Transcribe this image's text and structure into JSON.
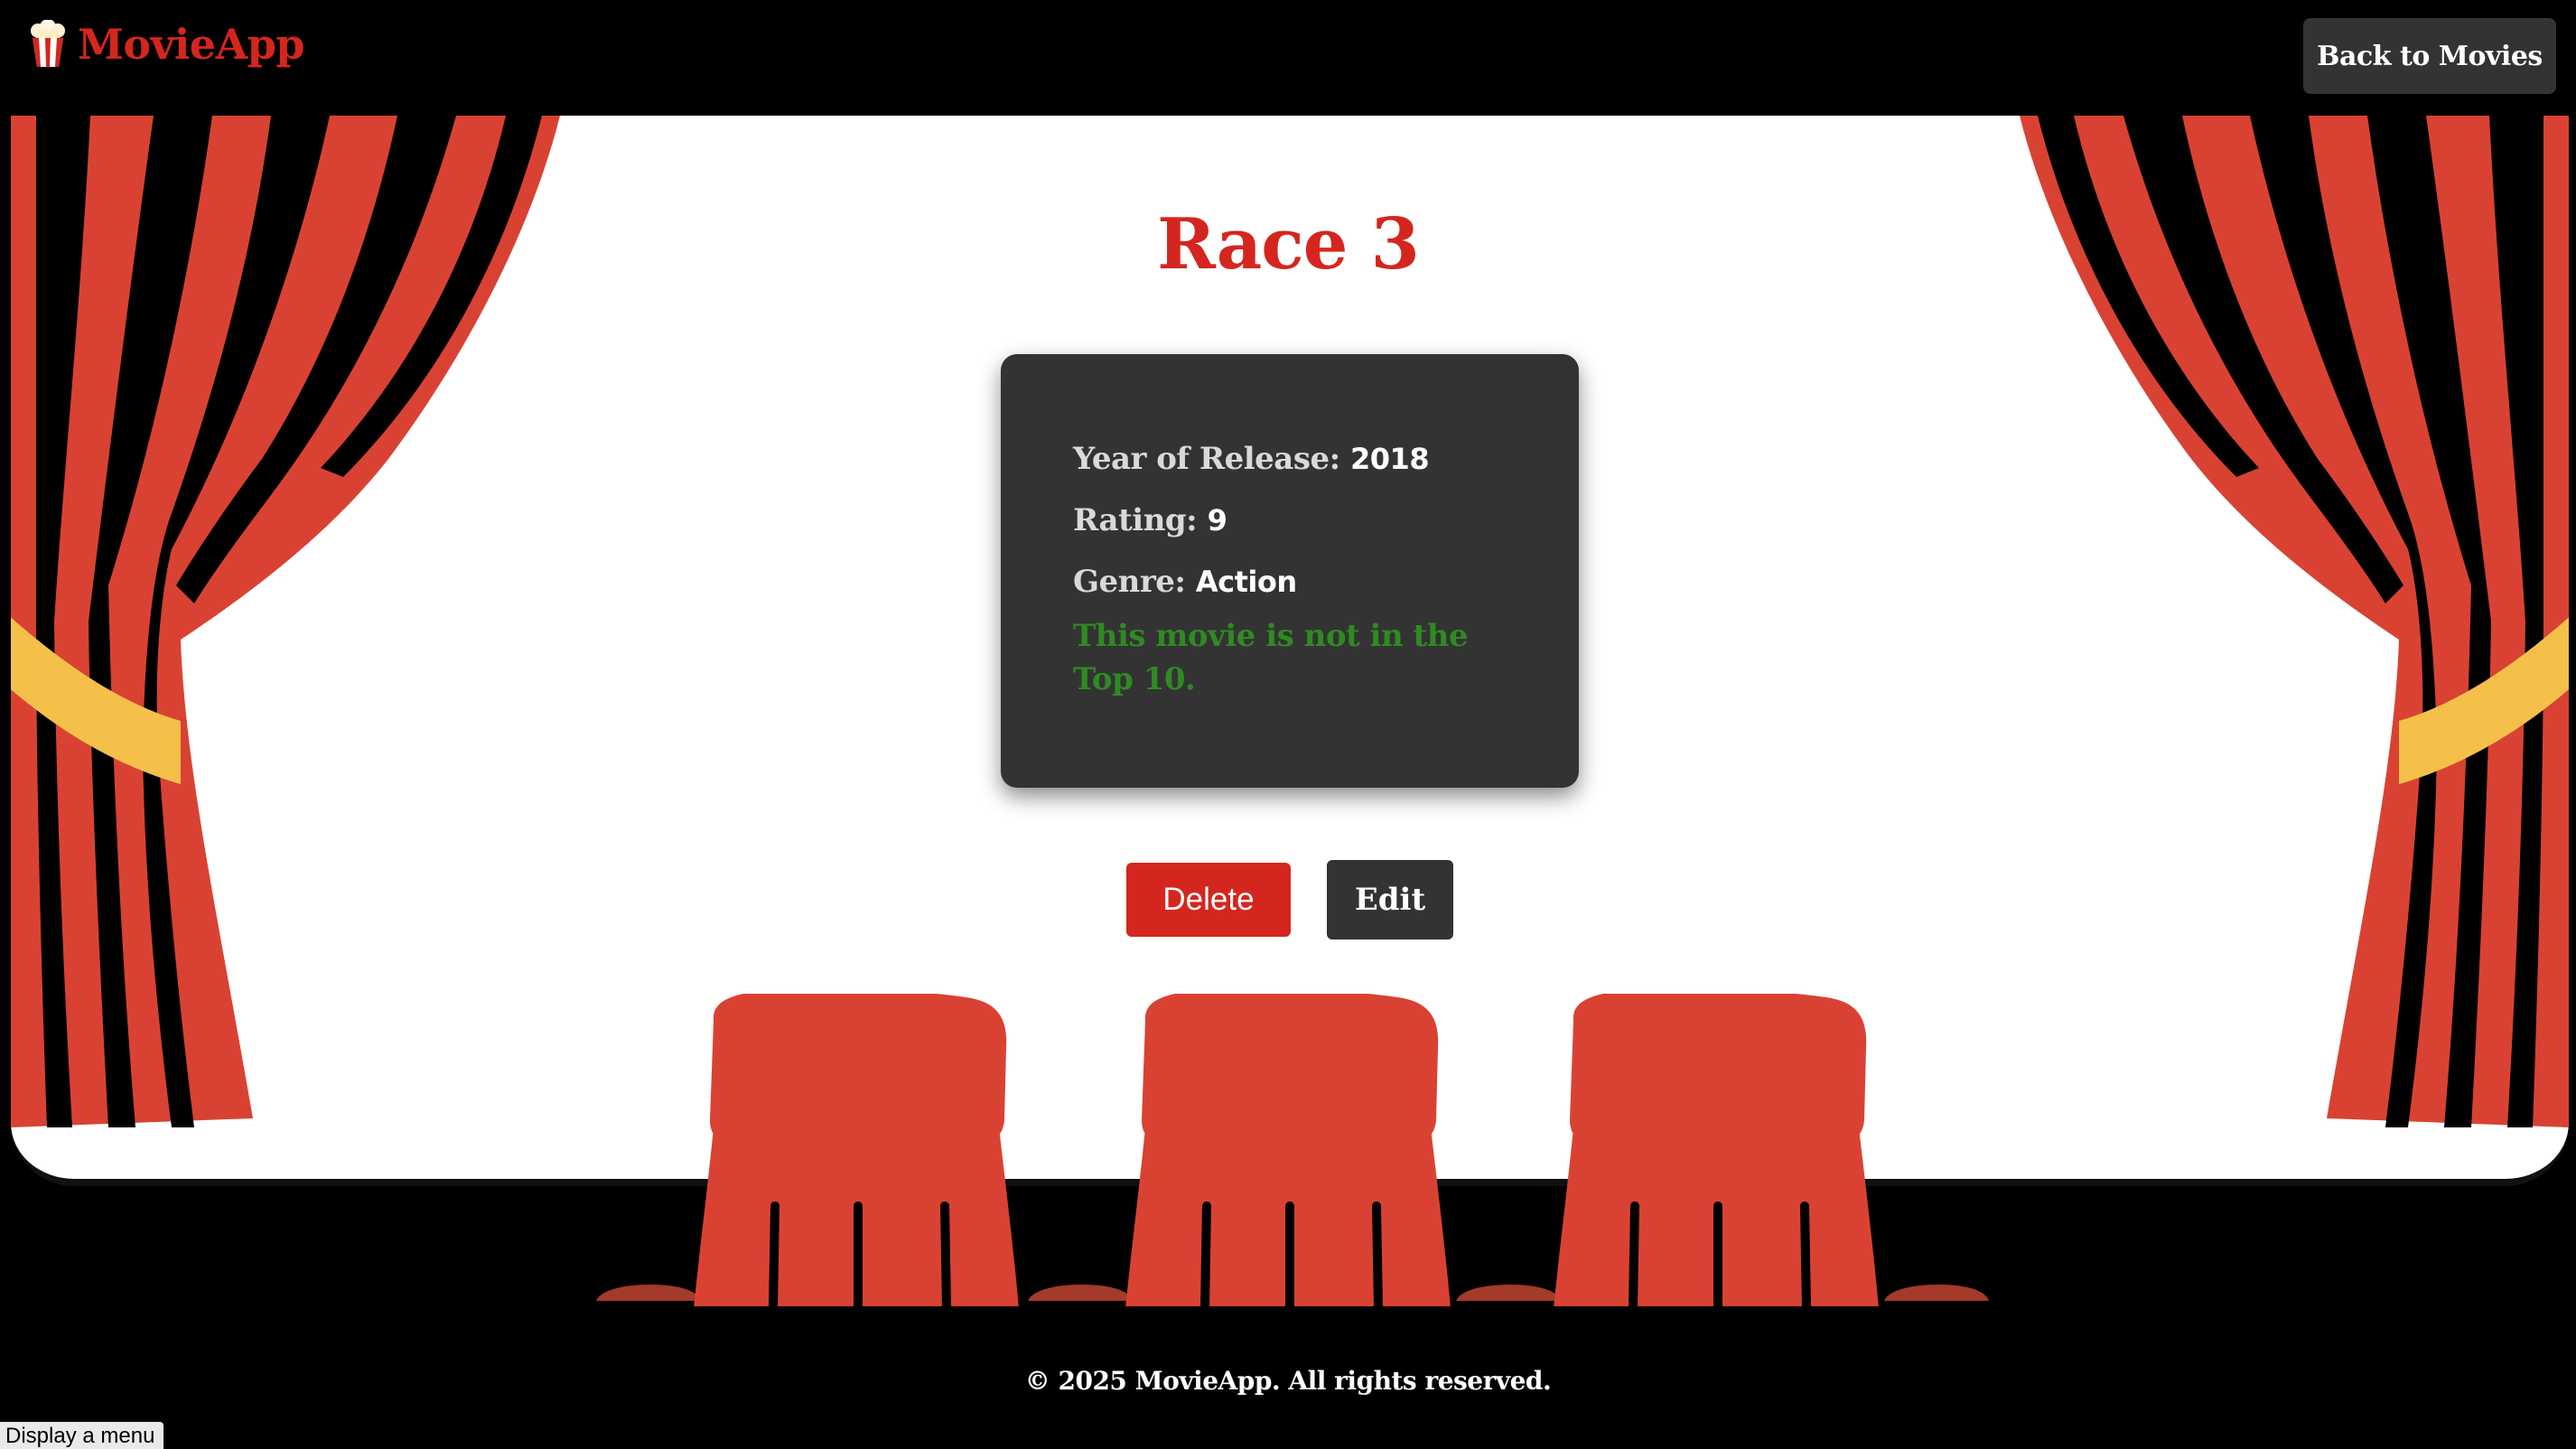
{
  "header": {
    "brand_name": "MovieApp",
    "brand_icon": "popcorn-icon",
    "back_label": "Back to Movies"
  },
  "movie": {
    "title": "Race 3",
    "year_label": "Year of Release:",
    "year": "2018",
    "rating_label": "Rating:",
    "rating": "9",
    "genre_label": "Genre:",
    "genre": "Action",
    "top10_status": "This movie is not in the Top 10."
  },
  "actions": {
    "delete_label": "Delete",
    "edit_label": "Edit"
  },
  "footer": {
    "copyright": "© 2025 MovieApp. All rights reserved."
  },
  "tooltip": {
    "text": "Display a menu"
  },
  "colors": {
    "brand_red": "#d4261e",
    "card_bg": "#333333",
    "status_green": "#2f8a22",
    "curtain_red": "#d94233",
    "tieback_gold": "#f4c04a"
  }
}
